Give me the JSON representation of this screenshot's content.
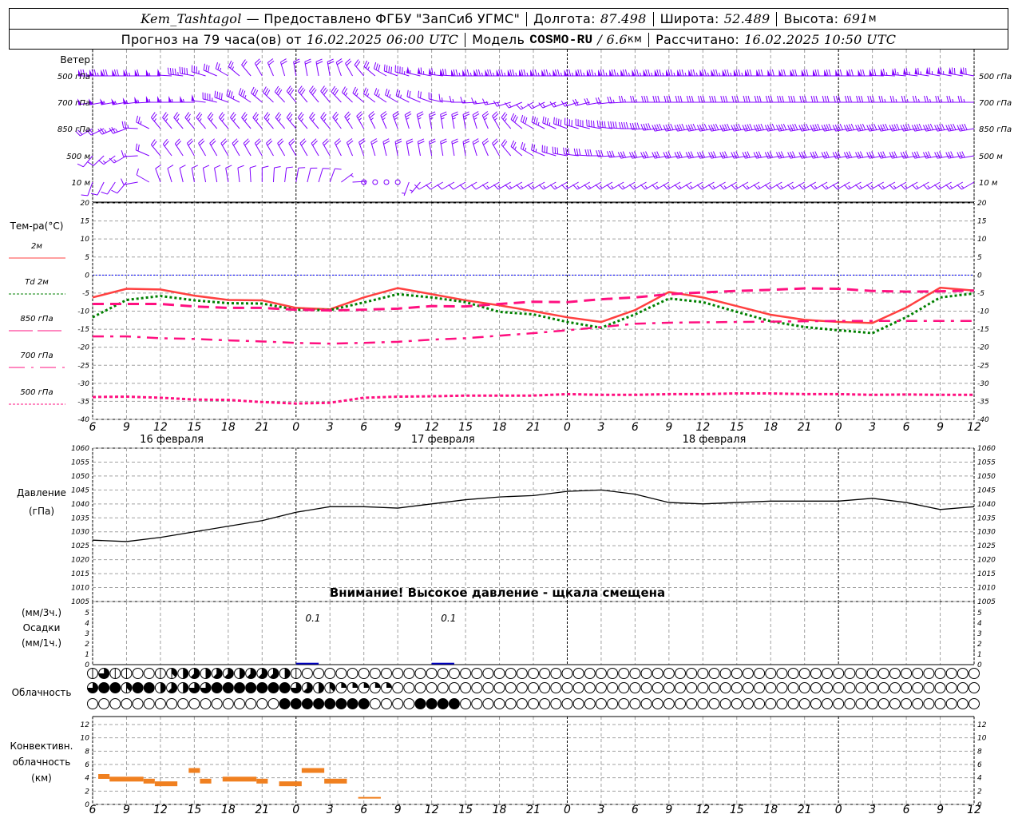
{
  "header": {
    "station": "Kem_Tashtagol",
    "provider": "— Предоставлено ФГБУ \"ЗапСиб УГМС\"",
    "lon_label": "Долгота:",
    "lon": "87.498",
    "lat_label": "Широта:",
    "lat": "52.489",
    "alt_label": "Высота:",
    "alt": "691",
    "alt_unit": "м",
    "forecast_label": "Прогноз на 79 часа(ов) от",
    "forecast_time": "16.02.2025 06:00 UTC",
    "model_label": "Модель",
    "model": "COSMO-RU",
    "res": "/ 6.6",
    "res_unit": "км",
    "calc_label": "Рассчитано:",
    "calc_time": "16.02.2025 10:50 UTC"
  },
  "labels": {
    "wind": "Ветер",
    "wind_levels": [
      "500 гПа",
      "700 гПа",
      "850 гПа",
      "500 м",
      "10  м"
    ],
    "temp_title": "Тем-ра(°C)",
    "legend": [
      {
        "text": "2м",
        "color": "#ff4040",
        "style": "solid"
      },
      {
        "text": "Td  2м",
        "color": "#008000",
        "style": "dotted"
      },
      {
        "text": "850 гПа",
        "color": "#ff1080",
        "style": "dashed"
      },
      {
        "text": "700 гПа",
        "color": "#ff1080",
        "style": "dashdot"
      },
      {
        "text": "500 гПа",
        "color": "#ff1080",
        "style": "fine-dotted"
      }
    ],
    "pressure_title": "Давление",
    "pressure_unit": "(гПа)",
    "pressure_warning": "Внимание! Высокое давление - щкала смещена",
    "precip_unit3": "(мм/3ч.)",
    "precip_title": "Осадки",
    "precip_unit1": "(мм/1ч.)",
    "cloud_title": "Облачность",
    "conv_title1": "Конвективн.",
    "conv_title2": "облачность",
    "conv_unit": "(км)"
  },
  "time_axis": {
    "labels": [
      "6",
      "9",
      "12",
      "15",
      "18",
      "21",
      "0",
      "3",
      "6",
      "9",
      "12",
      "15",
      "18",
      "21",
      "0",
      "3",
      "6",
      "9",
      "12",
      "15",
      "18",
      "21",
      "0",
      "3",
      "6",
      "9",
      "12"
    ],
    "days": [
      "16 февраля",
      "17 февраля",
      "18 февраля"
    ]
  },
  "colors": {
    "wind": "#8000ff",
    "t2m": "#ff4040",
    "td": "#008000",
    "upper": "#ff1080",
    "zero": "#0000ff",
    "precip": "#0000c0",
    "conv": "#f08020"
  },
  "chart_data": [
    {
      "type": "wind-barbs",
      "x_hours_from_start": [
        0,
        3,
        6,
        9,
        12,
        15,
        18,
        21,
        24,
        27,
        30,
        33,
        36,
        39,
        42,
        45,
        48,
        51,
        54,
        57,
        60,
        63,
        66,
        69,
        72,
        75,
        78
      ],
      "series": [
        {
          "name": "500 гПа",
          "dir": [
            270,
            270,
            270,
            280,
            300,
            330,
            350,
            350,
            320,
            290,
            280,
            270,
            270,
            270,
            270,
            270,
            270,
            270,
            270,
            270,
            270,
            270,
            270,
            270,
            275,
            280,
            280
          ],
          "speed": [
            30,
            28,
            22,
            15,
            10,
            8,
            8,
            8,
            8,
            15,
            25,
            30,
            30,
            30,
            30,
            30,
            30,
            30,
            30,
            30,
            28,
            28,
            28,
            28,
            25,
            25,
            28
          ]
        },
        {
          "name": "700 гПа",
          "dir": [
            260,
            260,
            270,
            270,
            290,
            310,
            320,
            320,
            310,
            300,
            290,
            270,
            260,
            240,
            250,
            260,
            270,
            270,
            270,
            270,
            270,
            270,
            270,
            270,
            270,
            270,
            270
          ],
          "speed": [
            20,
            22,
            22,
            22,
            15,
            12,
            12,
            12,
            10,
            10,
            8,
            6,
            5,
            5,
            6,
            8,
            10,
            12,
            12,
            12,
            12,
            12,
            12,
            12,
            10,
            10,
            10
          ]
        },
        {
          "name": "850 гПа",
          "dir": [
            240,
            250,
            320,
            320,
            320,
            320,
            320,
            320,
            330,
            340,
            350,
            350,
            330,
            300,
            290,
            280,
            270,
            260,
            260,
            260,
            260,
            260,
            260,
            260,
            260,
            260,
            260
          ],
          "speed": [
            8,
            10,
            10,
            10,
            10,
            10,
            10,
            10,
            10,
            10,
            10,
            10,
            10,
            12,
            15,
            15,
            15,
            15,
            15,
            15,
            15,
            15,
            15,
            15,
            15,
            15,
            15
          ]
        },
        {
          "name": "500 м",
          "dir": [
            220,
            240,
            320,
            330,
            330,
            330,
            330,
            330,
            340,
            350,
            350,
            350,
            330,
            300,
            280,
            270,
            260,
            260,
            260,
            260,
            260,
            260,
            260,
            260,
            260,
            260,
            260
          ],
          "speed": [
            4,
            6,
            8,
            8,
            8,
            8,
            8,
            8,
            8,
            8,
            8,
            8,
            8,
            10,
            12,
            12,
            12,
            12,
            12,
            12,
            12,
            12,
            12,
            12,
            12,
            12,
            12
          ]
        },
        {
          "name": "10  м",
          "dir": [
            200,
            220,
            340,
            350,
            350,
            0,
            10,
            20,
            120,
            180,
            240,
            240,
            240,
            240,
            240,
            240,
            240,
            240,
            240,
            240,
            240,
            240,
            240,
            240,
            240,
            240,
            240
          ],
          "speed": [
            3,
            3,
            4,
            4,
            4,
            4,
            4,
            3,
            1,
            1,
            3,
            4,
            5,
            5,
            5,
            5,
            5,
            5,
            5,
            5,
            5,
            5,
            5,
            5,
            5,
            5,
            5
          ]
        }
      ]
    },
    {
      "type": "line",
      "ylabel": "Тем-ра(°C)",
      "ylim": [
        -40,
        20
      ],
      "yticks": [
        20,
        15,
        10,
        5,
        0,
        -5,
        -10,
        -15,
        -20,
        -25,
        -30,
        -35,
        -40
      ],
      "grid": true,
      "x_hours_from_start": [
        0,
        3,
        6,
        9,
        12,
        15,
        18,
        21,
        24,
        27,
        30,
        33,
        36,
        39,
        42,
        45,
        48,
        51,
        54,
        57,
        60,
        63,
        66,
        69,
        72,
        75,
        78
      ],
      "series": [
        {
          "name": "2м",
          "values": [
            -6.2,
            -3.8,
            -4,
            -5.7,
            -6.9,
            -7,
            -9.1,
            -9.5,
            -6.2,
            -3.6,
            -5.3,
            -7,
            -8.4,
            -10,
            -11.7,
            -13,
            -9.7,
            -4.7,
            -6.2,
            -8.6,
            -11,
            -12.4,
            -13,
            -13.3,
            -9,
            -3.5,
            -4.3
          ]
        },
        {
          "name": "Td  2м",
          "values": [
            -11.7,
            -6.9,
            -5.8,
            -7,
            -7.8,
            -7.9,
            -9.6,
            -9.7,
            -7.6,
            -5.3,
            -6.2,
            -7.5,
            -10.2,
            -10.9,
            -13,
            -14.6,
            -10.9,
            -6.5,
            -7.5,
            -10.2,
            -12.8,
            -14.4,
            -15.3,
            -16.1,
            -11.7,
            -6.2,
            -5.1
          ]
        },
        {
          "name": "850 гПа",
          "values": [
            -8,
            -8,
            -8,
            -8.7,
            -9.1,
            -9.1,
            -9.6,
            -9.8,
            -9.6,
            -9.3,
            -8.6,
            -8.7,
            -8,
            -7.4,
            -7.5,
            -6.7,
            -6.2,
            -5.3,
            -4.8,
            -4.4,
            -4.1,
            -3.7,
            -3.8,
            -4.4,
            -4.6,
            -4.5,
            -4.3
          ]
        },
        {
          "name": "700 гПа",
          "values": [
            -17,
            -17,
            -17.5,
            -17.7,
            -18.1,
            -18.4,
            -18.8,
            -19,
            -18.8,
            -18.5,
            -17.9,
            -17.5,
            -16.8,
            -16.1,
            -15.3,
            -14.4,
            -13.5,
            -13.2,
            -13.1,
            -13,
            -12.9,
            -12.8,
            -12.7,
            -12.7,
            -12.7,
            -12.7,
            -12.7
          ]
        },
        {
          "name": "500 гПа",
          "values": [
            -33.8,
            -33.7,
            -34,
            -34.5,
            -34.6,
            -35.2,
            -35.6,
            -35.4,
            -34,
            -33.7,
            -33.6,
            -33.4,
            -33.4,
            -33.4,
            -33,
            -33.2,
            -33.2,
            -33,
            -33,
            -32.8,
            -32.8,
            -33,
            -33,
            -33.2,
            -33.1,
            -33.2,
            -33.2
          ]
        }
      ]
    },
    {
      "type": "line",
      "ylabel": "Давление (гПа)",
      "ylim": [
        1005,
        1060
      ],
      "yticks": [
        1060,
        1055,
        1050,
        1045,
        1040,
        1035,
        1030,
        1025,
        1020,
        1015,
        1010,
        1005
      ],
      "grid": true,
      "x_hours_from_start": [
        0,
        3,
        6,
        9,
        12,
        15,
        18,
        21,
        24,
        27,
        30,
        33,
        36,
        39,
        42,
        45,
        48,
        51,
        54,
        57,
        60,
        63,
        66,
        69,
        72,
        75,
        78
      ],
      "values": [
        1027,
        1026.5,
        1028,
        1030,
        1032,
        1034,
        1037,
        1039,
        1039,
        1038.5,
        1040,
        1041.5,
        1042.5,
        1043,
        1044.5,
        1045,
        1043.5,
        1040.5,
        1040,
        1040.5,
        1041,
        1041,
        1041,
        1042,
        1040.5,
        1038,
        1039
      ]
    },
    {
      "type": "bar",
      "ylabel": "Осадки",
      "ylim": [
        0,
        5
      ],
      "yticks": [
        0,
        1,
        2,
        3,
        4,
        5
      ],
      "bars_hours": [
        [
          18,
          20,
          0.1
        ],
        [
          30,
          32,
          0.1
        ]
      ],
      "annotations": [
        {
          "hour": 19.5,
          "text": "0.1"
        },
        {
          "hour": 31.5,
          "text": "0.1"
        }
      ]
    },
    {
      "type": "table",
      "name": "Облачность",
      "unit": "oktas per hour",
      "rows": [
        [
          1,
          6,
          1,
          1,
          0,
          0,
          1,
          3,
          4,
          5,
          4,
          5,
          5,
          4,
          5,
          5,
          5,
          4,
          1,
          0,
          0,
          0,
          0,
          0,
          0,
          0,
          0,
          0,
          0,
          0,
          0,
          0,
          0,
          0,
          0,
          0,
          0,
          0,
          0,
          0,
          0,
          0,
          0,
          0,
          0,
          0,
          0,
          0,
          0,
          0,
          0,
          0,
          0,
          0,
          0,
          0,
          0,
          0,
          0,
          0,
          0,
          0,
          0,
          0,
          0,
          0,
          0,
          0,
          0,
          0,
          0,
          0,
          0,
          0,
          0,
          0,
          0,
          0,
          0
        ],
        [
          6,
          8,
          8,
          3,
          8,
          8,
          4,
          5,
          4,
          6,
          6,
          8,
          8,
          8,
          8,
          8,
          8,
          8,
          6,
          5,
          4,
          3,
          2,
          2,
          2,
          2,
          2,
          0,
          0,
          0,
          0,
          0,
          0,
          0,
          0,
          0,
          0,
          0,
          0,
          0,
          0,
          0,
          0,
          0,
          0,
          0,
          0,
          0,
          0,
          0,
          0,
          0,
          0,
          0,
          0,
          0,
          0,
          0,
          0,
          0,
          0,
          0,
          0,
          0,
          0,
          0,
          0,
          0,
          0,
          0,
          0,
          0,
          0,
          0,
          0,
          0,
          0,
          0,
          0
        ],
        [
          0,
          0,
          0,
          0,
          0,
          0,
          0,
          0,
          0,
          0,
          0,
          0,
          0,
          0,
          0,
          0,
          0,
          8,
          8,
          8,
          8,
          8,
          8,
          8,
          8,
          0,
          0,
          0,
          0,
          8,
          8,
          8,
          8,
          0,
          0,
          0,
          0,
          0,
          0,
          0,
          0,
          0,
          0,
          0,
          0,
          0,
          0,
          0,
          0,
          0,
          0,
          0,
          0,
          0,
          0,
          0,
          0,
          0,
          0,
          0,
          0,
          0,
          0,
          0,
          0,
          0,
          0,
          0,
          0,
          0,
          0,
          0,
          0,
          0,
          0,
          0,
          0,
          0,
          0
        ]
      ]
    },
    {
      "type": "bar",
      "ylabel": "Конвективн. облачность (км)",
      "ylim": [
        0,
        13
      ],
      "yticks": [
        0,
        2,
        4,
        6,
        8,
        10,
        12
      ],
      "segments_hours_km": [
        [
          0.5,
          1.5,
          4.2
        ],
        [
          1.5,
          4.5,
          3.8
        ],
        [
          4.5,
          5.5,
          3.5
        ],
        [
          5.5,
          7.5,
          3.1
        ],
        [
          8.5,
          9.5,
          5.1
        ],
        [
          9.5,
          10.5,
          3.5
        ],
        [
          11.5,
          14.5,
          3.8
        ],
        [
          14.5,
          15.5,
          3.5
        ],
        [
          16.5,
          18.5,
          3.1
        ],
        [
          18.5,
          20.5,
          5.1
        ],
        [
          20.5,
          22.5,
          3.5
        ],
        [
          23.5,
          25.5,
          1.0
        ]
      ]
    }
  ]
}
